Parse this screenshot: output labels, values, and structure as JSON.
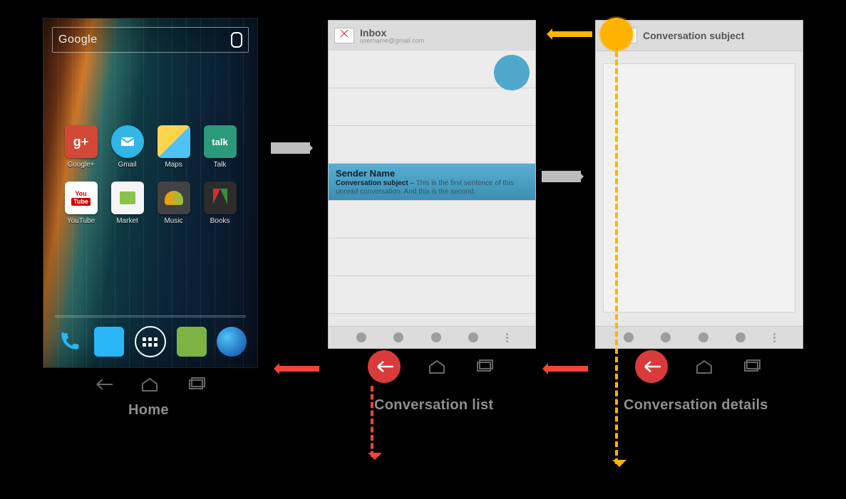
{
  "home": {
    "search_label": "Google",
    "apps": [
      {
        "id": "gplus",
        "label": "Google+"
      },
      {
        "id": "gmail",
        "label": "Gmail",
        "highlight": true
      },
      {
        "id": "maps",
        "label": "Maps"
      },
      {
        "id": "talk",
        "label": "Talk",
        "text": "talk"
      },
      {
        "id": "yt",
        "label": "YouTube"
      },
      {
        "id": "market",
        "label": "Market"
      },
      {
        "id": "music",
        "label": "Music"
      },
      {
        "id": "books",
        "label": "Books"
      }
    ],
    "caption": "Home"
  },
  "inbox": {
    "title": "Inbox",
    "subtitle": "username@gmail.com",
    "selected": {
      "sender": "Sender Name",
      "subject": "Conversation subject",
      "preview": "This is the first sentence of this unread conversation. And this is the second."
    },
    "caption": "Conversation list"
  },
  "detail": {
    "title": "Conversation subject",
    "caption": "Conversation details"
  },
  "yt_text": {
    "top": "You",
    "bar": "Tube"
  }
}
